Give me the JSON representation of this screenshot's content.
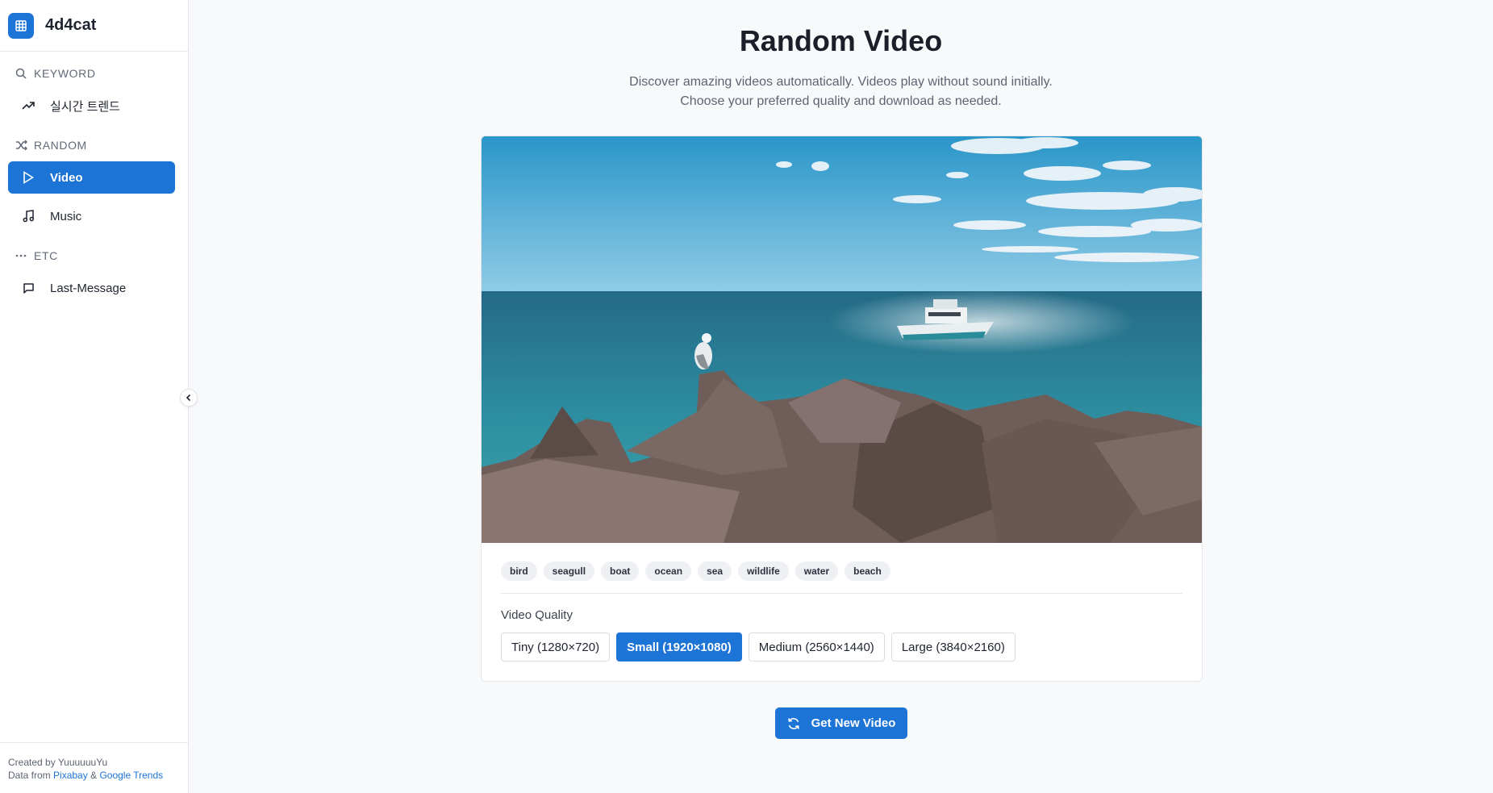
{
  "app": {
    "name": "4d4cat"
  },
  "sidebar": {
    "sections": [
      {
        "title": "KEYWORD",
        "icon": "search-icon",
        "items": [
          {
            "label": "실시간 트렌드",
            "icon": "trending-up-icon"
          }
        ]
      },
      {
        "title": "RANDOM",
        "icon": "shuffle-icon",
        "items": [
          {
            "label": "Video",
            "icon": "play-icon",
            "active": true
          },
          {
            "label": "Music",
            "icon": "music-note-icon"
          }
        ]
      },
      {
        "title": "ETC",
        "icon": "ellipsis-icon",
        "items": [
          {
            "label": "Last-Message",
            "icon": "message-square-icon"
          }
        ]
      }
    ],
    "footer": {
      "created_by": "Created by YuuuuuuYu",
      "data_from": "Data from",
      "pixabay": "Pixabay",
      "amp": "&",
      "google_trends": "Google Trends"
    }
  },
  "main": {
    "title": "Random Video",
    "description_line1": "Discover amazing videos automatically. Videos play without sound initially.",
    "description_line2": "Choose your preferred quality and download as needed.",
    "tags": [
      "bird",
      "seagull",
      "boat",
      "ocean",
      "sea",
      "wildlife",
      "water",
      "beach"
    ],
    "quality_label": "Video Quality",
    "quality_options": [
      {
        "label": "Tiny (1280×720)",
        "selected": false
      },
      {
        "label": "Small (1920×1080)",
        "selected": true
      },
      {
        "label": "Medium (2560×1440)",
        "selected": false
      },
      {
        "label": "Large (3840×2160)",
        "selected": false
      }
    ],
    "get_new_button": "Get New Video"
  },
  "colors": {
    "accent": "#1c74d6",
    "background": "#f8f9fb",
    "sidebar": "#ffffff"
  }
}
